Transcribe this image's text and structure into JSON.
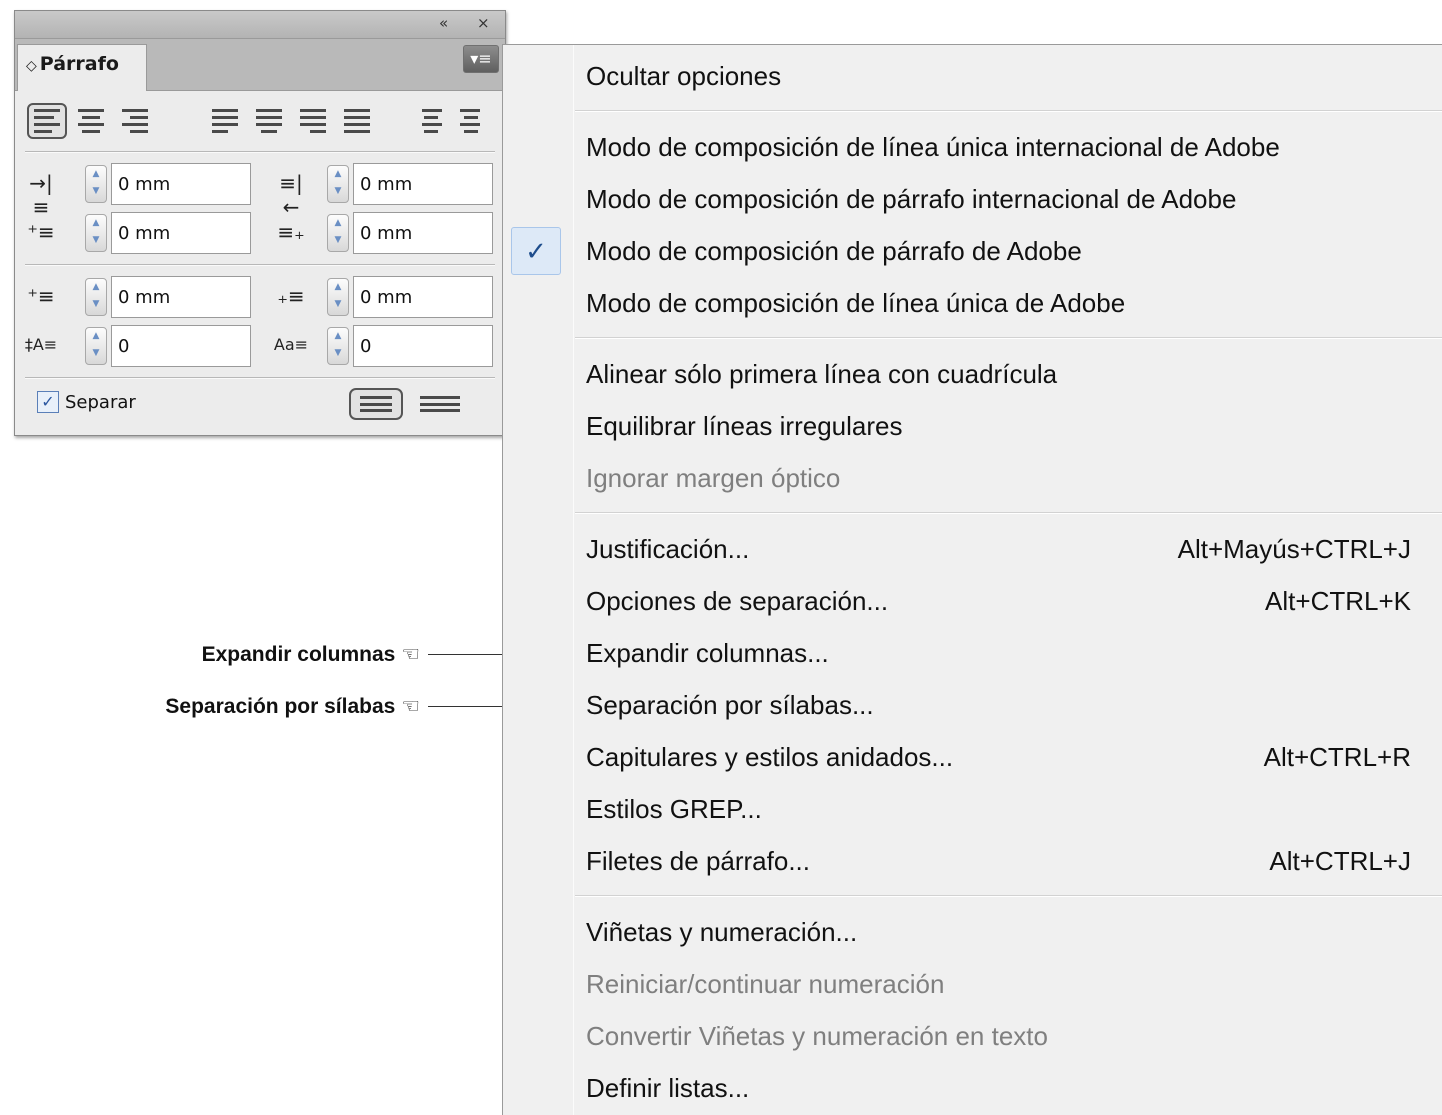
{
  "panel": {
    "title": "Párrafo",
    "tab_arrows": "◇",
    "collapse_icon": "«",
    "close_icon": "×",
    "menu_icon": "▾≡",
    "fields": [
      {
        "icon": "→|≡",
        "value": "0 mm"
      },
      {
        "icon": "≡|←",
        "value": "0 mm"
      },
      {
        "icon": "⁺≡",
        "value": "0 mm"
      },
      {
        "icon": "≡₊",
        "value": "0 mm"
      },
      {
        "icon": "⁺≡",
        "value": "0 mm"
      },
      {
        "icon": "₊≡",
        "value": "0 mm"
      },
      {
        "icon": "‡A≡",
        "value": "0"
      },
      {
        "icon": "Aa≡",
        "value": "0"
      }
    ],
    "hyphenate_label": "Separar",
    "hyphenate_checked": "✓"
  },
  "menu": {
    "items": [
      {
        "label": "Ocultar opciones",
        "shortcut": "",
        "disabled": false,
        "checked": false
      },
      {
        "label": "Modo de composición de línea única internacional de Adobe",
        "shortcut": "",
        "disabled": false,
        "checked": false
      },
      {
        "label": "Modo de composición de párrafo internacional de Adobe",
        "shortcut": "",
        "disabled": false,
        "checked": false
      },
      {
        "label": "Modo de composición de párrafo de Adobe",
        "shortcut": "",
        "disabled": false,
        "checked": true
      },
      {
        "label": "Modo de composición de línea única de Adobe",
        "shortcut": "",
        "disabled": false,
        "checked": false
      },
      {
        "label": "Alinear sólo primera línea con cuadrícula",
        "shortcut": "",
        "disabled": false,
        "checked": false
      },
      {
        "label": "Equilibrar líneas irregulares",
        "shortcut": "",
        "disabled": false,
        "checked": false
      },
      {
        "label": "Ignorar margen óptico",
        "shortcut": "",
        "disabled": true,
        "checked": false
      },
      {
        "label": "Justificación...",
        "shortcut": "Alt+Mayús+CTRL+J",
        "disabled": false,
        "checked": false
      },
      {
        "label": "Opciones de separación...",
        "shortcut": "Alt+CTRL+K",
        "disabled": false,
        "checked": false
      },
      {
        "label": "Expandir columnas...",
        "shortcut": "",
        "disabled": false,
        "checked": false
      },
      {
        "label": "Separación por sílabas...",
        "shortcut": "",
        "disabled": false,
        "checked": false
      },
      {
        "label": "Capitulares y estilos anidados...",
        "shortcut": "Alt+CTRL+R",
        "disabled": false,
        "checked": false
      },
      {
        "label": "Estilos GREP...",
        "shortcut": "",
        "disabled": false,
        "checked": false
      },
      {
        "label": "Filetes de párrafo...",
        "shortcut": "Alt+CTRL+J",
        "disabled": false,
        "checked": false
      },
      {
        "label": "Viñetas y numeración...",
        "shortcut": "",
        "disabled": false,
        "checked": false
      },
      {
        "label": "Reiniciar/continuar numeración",
        "shortcut": "",
        "disabled": true,
        "checked": false
      },
      {
        "label": "Convertir Viñetas y numeración en texto",
        "shortcut": "",
        "disabled": true,
        "checked": false
      },
      {
        "label": "Definir listas...",
        "shortcut": "",
        "disabled": false,
        "checked": false
      }
    ],
    "check_glyph": "✓"
  },
  "callouts": [
    {
      "text": "Expandir columnas ☜"
    },
    {
      "text": "Separación por sílabas ☜"
    }
  ],
  "colors": {
    "menu_bg": "#f0f0f0",
    "panel_bg": "#ececec",
    "check_highlight": "#dde9f7",
    "disabled_text": "#7f7f7f"
  }
}
